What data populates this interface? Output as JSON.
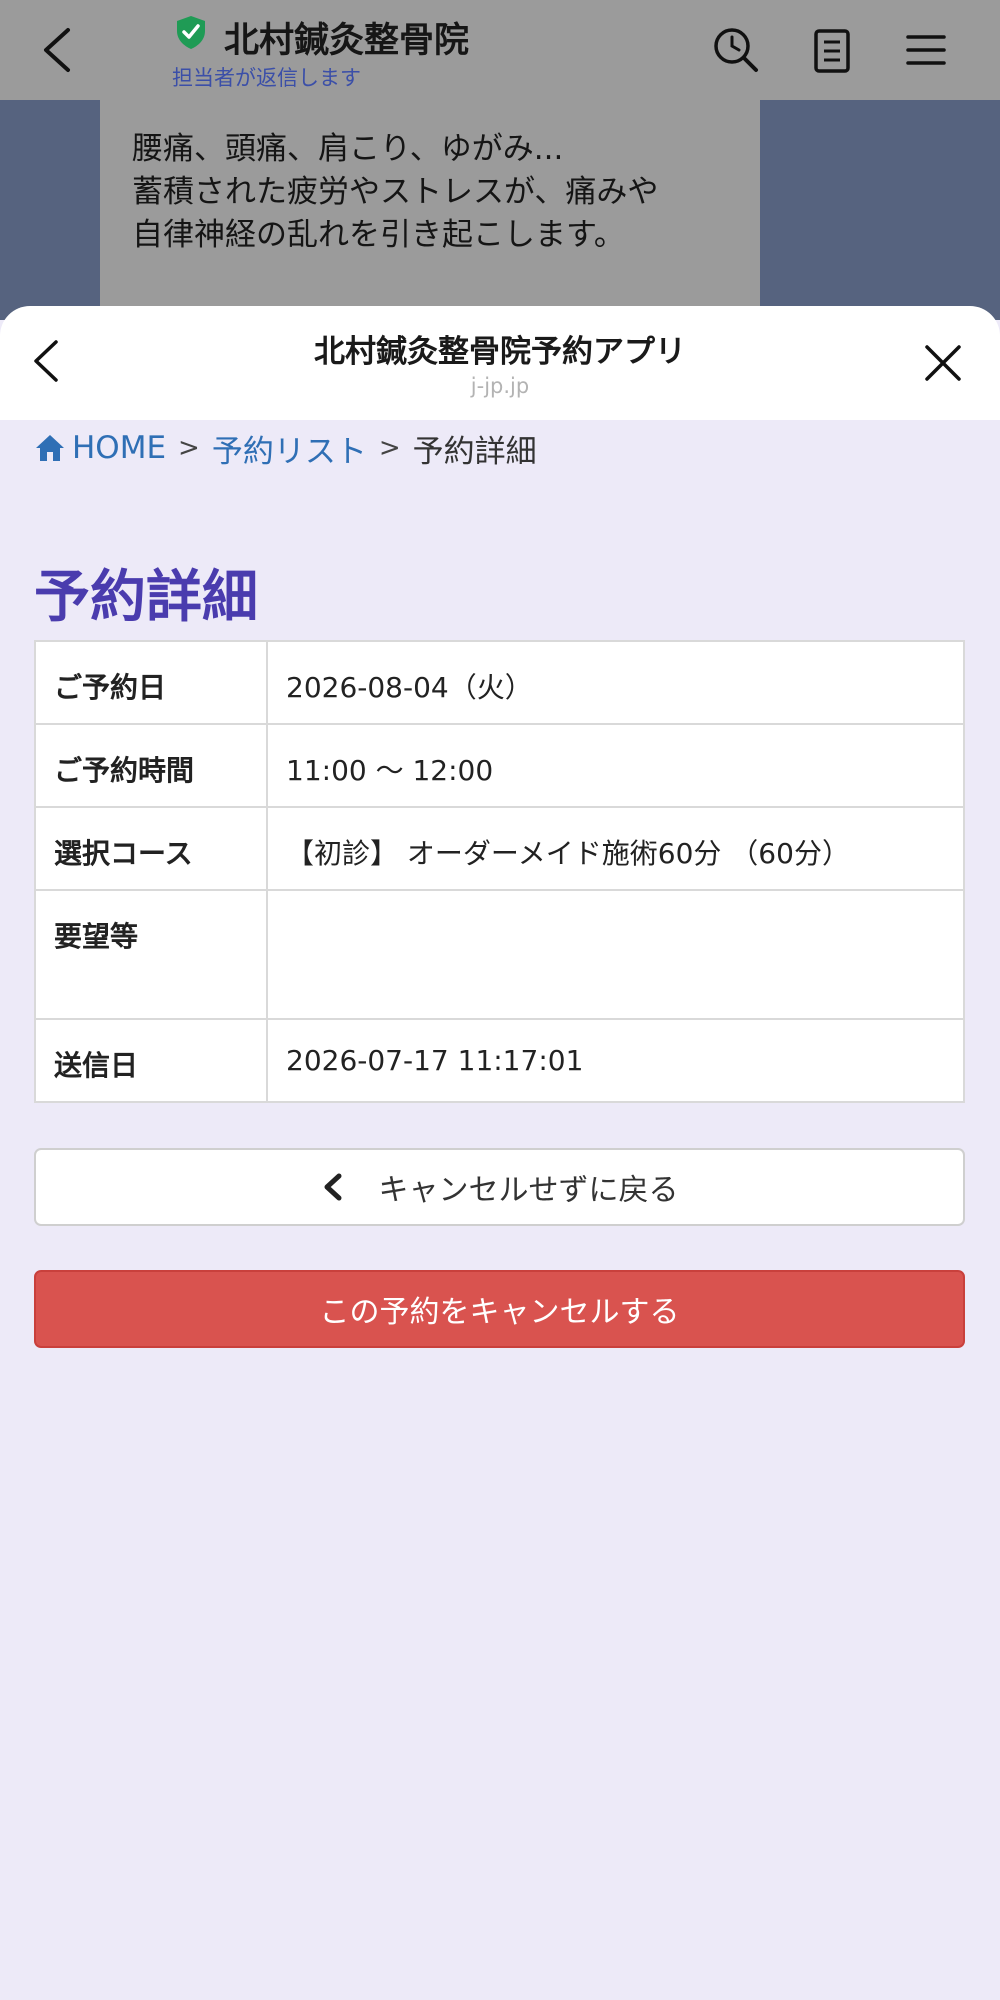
{
  "chat": {
    "title": "北村鍼灸整骨院",
    "subtitle": "担当者が返信します",
    "message_lines": [
      "腰痛、頭痛、肩こり、ゆがみ...",
      "蓄積された疲労やストレスが、痛みや",
      "自律神経の乱れを引き起こします。"
    ]
  },
  "sheet": {
    "title": "北村鍼灸整骨院予約アプリ",
    "domain": "j-jp.jp"
  },
  "breadcrumb": {
    "home": "HOME",
    "sep": ">",
    "list": "予約リスト",
    "current": "予約詳細"
  },
  "page": {
    "title": "予約詳細"
  },
  "details": {
    "rows": [
      {
        "label": "ご予約日",
        "value": "2026-08-04（火）"
      },
      {
        "label": "ご予約時間",
        "value": "11:00 〜 12:00"
      },
      {
        "label": "選択コース",
        "value": "【初診】 オーダーメイド施術60分 （60分）"
      },
      {
        "label": "要望等",
        "value": ""
      },
      {
        "label": "送信日",
        "value": "2026-07-17 11:17:01"
      }
    ]
  },
  "buttons": {
    "back": "キャンセルせずに戻る",
    "cancel": "この予約をキャンセルする"
  },
  "colors": {
    "accent": "#4a3cae",
    "link": "#2f6fb5",
    "danger": "#d9534f",
    "verified": "#1f9b55"
  },
  "icons": {
    "chat_back": "chevron-left-icon",
    "verified": "shield-check-icon",
    "search": "search-clock-icon",
    "notes": "notes-icon",
    "menu": "hamburger-menu-icon",
    "sheet_back": "chevron-left-icon",
    "sheet_close": "close-icon",
    "home": "home-icon",
    "button_back": "chevron-left-icon"
  }
}
